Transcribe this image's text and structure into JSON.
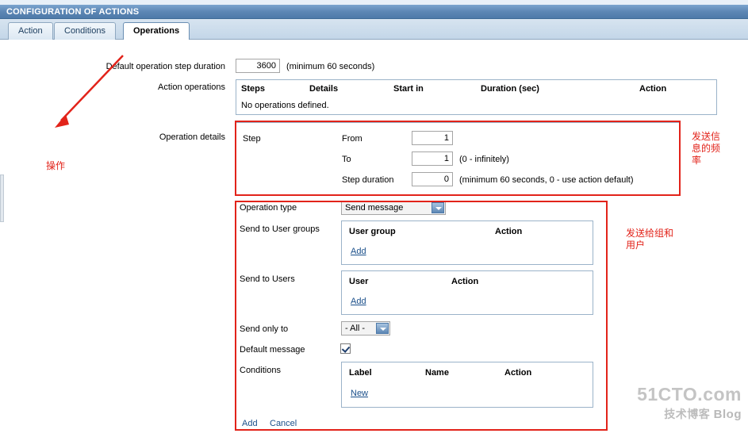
{
  "window": {
    "title": "CONFIGURATION OF ACTIONS"
  },
  "tabs": [
    {
      "label": "Action",
      "active": false
    },
    {
      "label": "Conditions",
      "active": false
    },
    {
      "label": "Operations",
      "active": true
    }
  ],
  "form": {
    "default_step_duration": {
      "label": "Default operation step duration",
      "value": "3600",
      "hint": "(minimum 60 seconds)"
    },
    "action_operations": {
      "label": "Action operations",
      "columns": [
        "Steps",
        "Details",
        "Start in",
        "Duration (sec)",
        "Action"
      ],
      "empty_text": "No operations defined."
    },
    "operation_details": {
      "label": "Operation details",
      "step_label": "Step",
      "from_label": "From",
      "from_value": "1",
      "to_label": "To",
      "to_value": "1",
      "to_hint": "(0 - infinitely)",
      "step_duration_label": "Step duration",
      "step_duration_value": "0",
      "step_duration_hint": "(minimum 60 seconds, 0 - use action default)"
    },
    "operation_type": {
      "label": "Operation type",
      "selected": "Send message"
    },
    "send_to_user_groups": {
      "label": "Send to User groups",
      "columns": [
        "User group",
        "Action"
      ],
      "add_link": "Add"
    },
    "send_to_users": {
      "label": "Send to Users",
      "columns": [
        "User",
        "Action"
      ],
      "add_link": "Add"
    },
    "send_only_to": {
      "label": "Send only to",
      "selected": "- All -"
    },
    "default_message": {
      "label": "Default message",
      "checked": true
    },
    "conditions": {
      "label": "Conditions",
      "columns": [
        "Label",
        "Name",
        "Action"
      ],
      "new_link": "New"
    },
    "footer": {
      "add_link": "Add",
      "cancel_link": "Cancel"
    }
  },
  "annotations": [
    {
      "text": "操作"
    },
    {
      "text": "发送信\n息的频\n率"
    },
    {
      "text": "发送给组和\n用户"
    }
  ],
  "watermark": {
    "line1": "51CTO.com",
    "line2_left": "技术博客",
    "line2_right": "Blog"
  },
  "colors": {
    "annotation_red": "#e2231a",
    "title_bar_blue": "#5d87b5",
    "link_blue": "#1a4f8a"
  }
}
